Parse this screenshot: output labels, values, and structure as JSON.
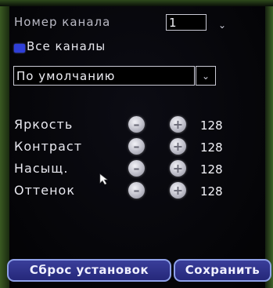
{
  "channel": {
    "label": "Номер канала",
    "value": "1"
  },
  "all_channels": {
    "label": "Все каналы",
    "checked": true
  },
  "preset": {
    "value": "По умолчанию"
  },
  "adjustments": [
    {
      "label": "Яркость",
      "value": "128"
    },
    {
      "label": "Контраст",
      "value": "128"
    },
    {
      "label": "Насыщ.",
      "value": "128"
    },
    {
      "label": "Оттенок",
      "value": "128"
    }
  ],
  "buttons": {
    "reset": "Сброс установок",
    "save": "Сохранить"
  },
  "icons": {
    "decrease": "minus-icon",
    "increase": "plus-icon",
    "dropdown": "chevron-down-icon",
    "pointer": "mouse-pointer-icon"
  },
  "colors": {
    "background": "#050508",
    "checkbox": "#2f3fd8",
    "button_fill": "#2f328a",
    "button_border": "#8ea0e8"
  }
}
